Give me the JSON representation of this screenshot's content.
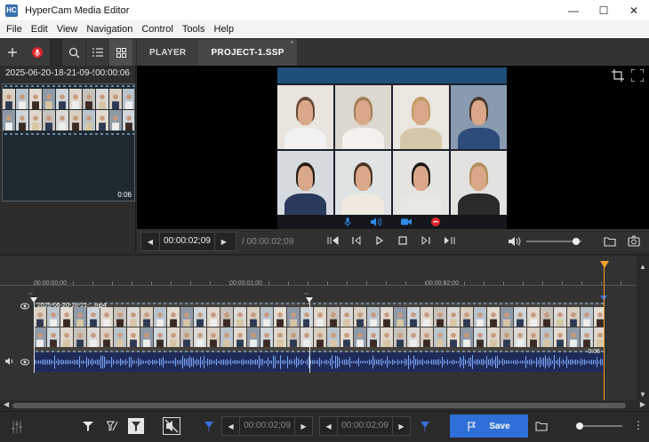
{
  "window": {
    "title": "HyperCam Media Editor",
    "logo_text": "HC",
    "controls": [
      "—",
      "☐",
      "✕"
    ]
  },
  "menu": [
    "File",
    "Edit",
    "View",
    "Navigation",
    "Control",
    "Tools",
    "Help"
  ],
  "media": {
    "filename": "2025-06-20-18-21-09-5...",
    "duration": "00:00:06",
    "thumb_duration": "0:06"
  },
  "tabs": {
    "player": "PLAYER",
    "project": "PROJECT-1.SSP",
    "close": "×"
  },
  "transport": {
    "current_time": "00:00:02;09",
    "total_time": "/ 00:00:02;09",
    "volume": 0.9
  },
  "timeline": {
    "ticks": [
      "00:00:00;00",
      "00:00:01;00",
      "00:00:02;00"
    ],
    "clip_name": "2025-06-20-18-21-...mp4",
    "clip_duration": "0:06"
  },
  "bottom": {
    "start_time": "00:00:02;09",
    "end_time": "00:00:02;09",
    "save_label": "Save",
    "zoom": 0.0
  },
  "colors": {
    "accent": "#2e6fd8",
    "playhead": "#f2a12a",
    "record": "#e0242c",
    "call_icons": "#2e8ce8",
    "audio_track": "#1e2b58"
  }
}
